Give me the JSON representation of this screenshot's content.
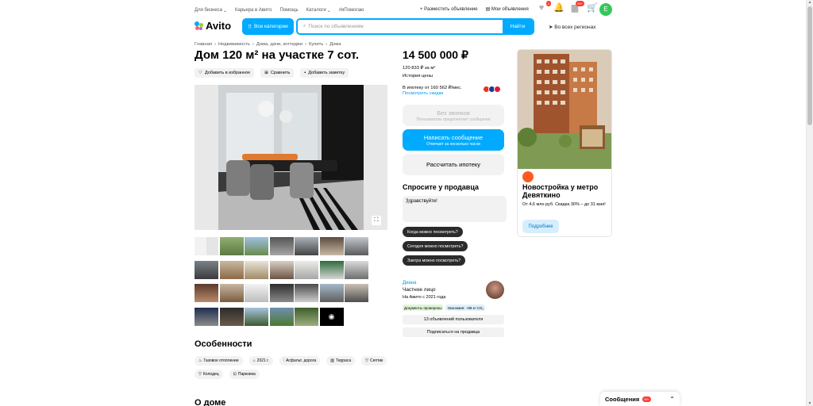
{
  "topnav": {
    "links": [
      "Для бизнеса",
      "Карьера в Авито",
      "Помощь",
      "Каталоги",
      "#яПомогаю"
    ],
    "place_ad": "Разместить объявление",
    "my_ads": "Мои объявления",
    "badge_notif": "1",
    "badge_msgs": "99+",
    "avatar_letter": "E"
  },
  "header": {
    "logo": "Avito",
    "all_categories": "Все категории",
    "search_placeholder": "Поиск по объявлениям",
    "search_button": "Найти",
    "region": "Во всех регионах"
  },
  "breadcrumbs": [
    "Главная",
    "Недвижимость",
    "Дома, дачи, коттеджи",
    "Купить",
    "Дома"
  ],
  "listing": {
    "title": "Дом 120 м² на участке 7 сот.",
    "actions": [
      "Добавить в избранное",
      "Сравнить",
      "Добавить заметку"
    ],
    "features_heading": "Особенности",
    "features": [
      "Газовое отопление",
      "2021 г.",
      "Асфальт. дорога",
      "Терраса",
      "Септик",
      "Колодец",
      "Парковка"
    ],
    "about_heading": "О доме"
  },
  "price": {
    "value": "14 500 000 ₽",
    "per_m2": "120 833 ₽ за м²",
    "history": "История цены",
    "mortgage_line": "В ипотеку от 160 562 ₽/мес.",
    "discounts": "Посмотреть скидки"
  },
  "buttons": {
    "no_calls_title": "Без звонков",
    "no_calls_sub": "Пользователь предпочитает сообщения",
    "write_title": "Написать сообщение",
    "write_sub": "Отвечает за несколько часов",
    "mortgage_calc": "Рассчитать ипотеку"
  },
  "ask_seller": {
    "heading": "Спросите у продавца",
    "message": "Здравствуйте!",
    "quick_questions": [
      "Когда можно посмотреть?",
      "Сегодня можно посмотреть?",
      "Завтра можно посмотреть?"
    ]
  },
  "seller": {
    "name": "Диана",
    "type": "Частное лицо",
    "since": "На Авито с 2021 года",
    "tag_docs": "Документы проверены",
    "tag_eco": "Экономия: ~88 кг CO₂",
    "ads_count": "13 объявлений пользователя",
    "subscribe": "Подписаться на продавца"
  },
  "ad_card": {
    "title": "Новостройка у метро Девяткино",
    "text": "От 4,6 млн руб. Скидка 30% – до 31 мая!",
    "button": "Подробнее"
  },
  "messages_widget": {
    "label": "Сообщения",
    "count": "99+"
  },
  "colors": {
    "accent": "#00aaff",
    "link": "#0099f7",
    "dark_button": "#2b2b2b",
    "avatar": "#34c759"
  }
}
